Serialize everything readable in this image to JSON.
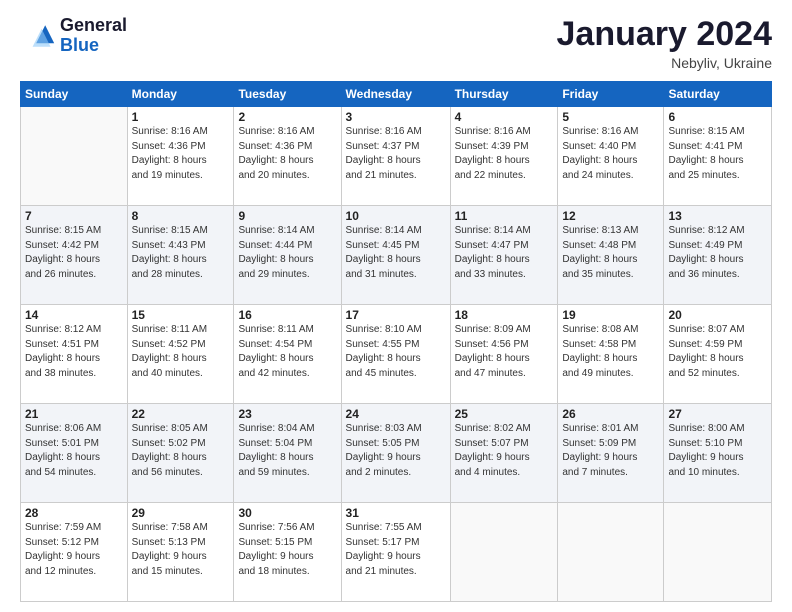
{
  "logo": {
    "line1": "General",
    "line2": "Blue"
  },
  "title": "January 2024",
  "location": "Nebyliv, Ukraine",
  "weekdays": [
    "Sunday",
    "Monday",
    "Tuesday",
    "Wednesday",
    "Thursday",
    "Friday",
    "Saturday"
  ],
  "weeks": [
    [
      {
        "day": "",
        "info": ""
      },
      {
        "day": "1",
        "info": "Sunrise: 8:16 AM\nSunset: 4:36 PM\nDaylight: 8 hours\nand 19 minutes."
      },
      {
        "day": "2",
        "info": "Sunrise: 8:16 AM\nSunset: 4:36 PM\nDaylight: 8 hours\nand 20 minutes."
      },
      {
        "day": "3",
        "info": "Sunrise: 8:16 AM\nSunset: 4:37 PM\nDaylight: 8 hours\nand 21 minutes."
      },
      {
        "day": "4",
        "info": "Sunrise: 8:16 AM\nSunset: 4:39 PM\nDaylight: 8 hours\nand 22 minutes."
      },
      {
        "day": "5",
        "info": "Sunrise: 8:16 AM\nSunset: 4:40 PM\nDaylight: 8 hours\nand 24 minutes."
      },
      {
        "day": "6",
        "info": "Sunrise: 8:15 AM\nSunset: 4:41 PM\nDaylight: 8 hours\nand 25 minutes."
      }
    ],
    [
      {
        "day": "7",
        "info": "Sunrise: 8:15 AM\nSunset: 4:42 PM\nDaylight: 8 hours\nand 26 minutes."
      },
      {
        "day": "8",
        "info": "Sunrise: 8:15 AM\nSunset: 4:43 PM\nDaylight: 8 hours\nand 28 minutes."
      },
      {
        "day": "9",
        "info": "Sunrise: 8:14 AM\nSunset: 4:44 PM\nDaylight: 8 hours\nand 29 minutes."
      },
      {
        "day": "10",
        "info": "Sunrise: 8:14 AM\nSunset: 4:45 PM\nDaylight: 8 hours\nand 31 minutes."
      },
      {
        "day": "11",
        "info": "Sunrise: 8:14 AM\nSunset: 4:47 PM\nDaylight: 8 hours\nand 33 minutes."
      },
      {
        "day": "12",
        "info": "Sunrise: 8:13 AM\nSunset: 4:48 PM\nDaylight: 8 hours\nand 35 minutes."
      },
      {
        "day": "13",
        "info": "Sunrise: 8:12 AM\nSunset: 4:49 PM\nDaylight: 8 hours\nand 36 minutes."
      }
    ],
    [
      {
        "day": "14",
        "info": "Sunrise: 8:12 AM\nSunset: 4:51 PM\nDaylight: 8 hours\nand 38 minutes."
      },
      {
        "day": "15",
        "info": "Sunrise: 8:11 AM\nSunset: 4:52 PM\nDaylight: 8 hours\nand 40 minutes."
      },
      {
        "day": "16",
        "info": "Sunrise: 8:11 AM\nSunset: 4:54 PM\nDaylight: 8 hours\nand 42 minutes."
      },
      {
        "day": "17",
        "info": "Sunrise: 8:10 AM\nSunset: 4:55 PM\nDaylight: 8 hours\nand 45 minutes."
      },
      {
        "day": "18",
        "info": "Sunrise: 8:09 AM\nSunset: 4:56 PM\nDaylight: 8 hours\nand 47 minutes."
      },
      {
        "day": "19",
        "info": "Sunrise: 8:08 AM\nSunset: 4:58 PM\nDaylight: 8 hours\nand 49 minutes."
      },
      {
        "day": "20",
        "info": "Sunrise: 8:07 AM\nSunset: 4:59 PM\nDaylight: 8 hours\nand 52 minutes."
      }
    ],
    [
      {
        "day": "21",
        "info": "Sunrise: 8:06 AM\nSunset: 5:01 PM\nDaylight: 8 hours\nand 54 minutes."
      },
      {
        "day": "22",
        "info": "Sunrise: 8:05 AM\nSunset: 5:02 PM\nDaylight: 8 hours\nand 56 minutes."
      },
      {
        "day": "23",
        "info": "Sunrise: 8:04 AM\nSunset: 5:04 PM\nDaylight: 8 hours\nand 59 minutes."
      },
      {
        "day": "24",
        "info": "Sunrise: 8:03 AM\nSunset: 5:05 PM\nDaylight: 9 hours\nand 2 minutes."
      },
      {
        "day": "25",
        "info": "Sunrise: 8:02 AM\nSunset: 5:07 PM\nDaylight: 9 hours\nand 4 minutes."
      },
      {
        "day": "26",
        "info": "Sunrise: 8:01 AM\nSunset: 5:09 PM\nDaylight: 9 hours\nand 7 minutes."
      },
      {
        "day": "27",
        "info": "Sunrise: 8:00 AM\nSunset: 5:10 PM\nDaylight: 9 hours\nand 10 minutes."
      }
    ],
    [
      {
        "day": "28",
        "info": "Sunrise: 7:59 AM\nSunset: 5:12 PM\nDaylight: 9 hours\nand 12 minutes."
      },
      {
        "day": "29",
        "info": "Sunrise: 7:58 AM\nSunset: 5:13 PM\nDaylight: 9 hours\nand 15 minutes."
      },
      {
        "day": "30",
        "info": "Sunrise: 7:56 AM\nSunset: 5:15 PM\nDaylight: 9 hours\nand 18 minutes."
      },
      {
        "day": "31",
        "info": "Sunrise: 7:55 AM\nSunset: 5:17 PM\nDaylight: 9 hours\nand 21 minutes."
      },
      {
        "day": "",
        "info": ""
      },
      {
        "day": "",
        "info": ""
      },
      {
        "day": "",
        "info": ""
      }
    ]
  ]
}
